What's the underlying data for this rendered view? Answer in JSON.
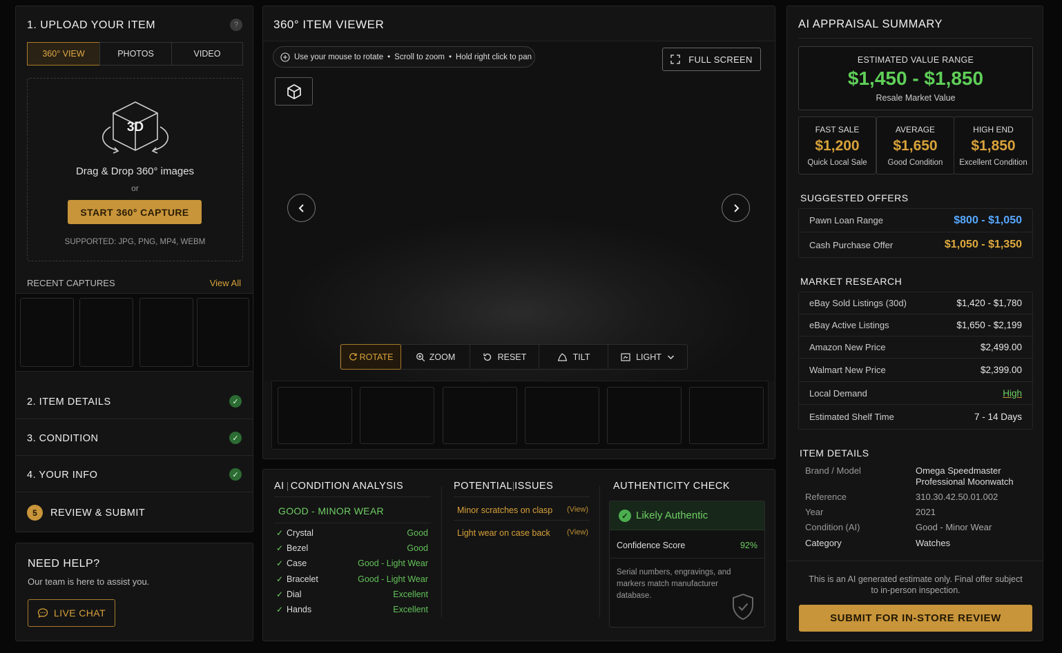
{
  "upload": {
    "title": "1. UPLOAD YOUR ITEM",
    "help_glyph": "?",
    "tabs": [
      "360° VIEW",
      "PHOTOS",
      "VIDEO"
    ],
    "drop_badge": "3D",
    "drop_text": "Drag & Drop 360° images",
    "or": "or",
    "capture_button": "START 360° CAPTURE",
    "supported": "SUPPORTED: JPG, PNG, MP4, WEBM",
    "recent_label": "RECENT CAPTURES",
    "view_all": "View All"
  },
  "steps": [
    {
      "label": "2. ITEM DETAILS"
    },
    {
      "label": "3. CONDITION"
    },
    {
      "label": "4. YOUR INFO"
    },
    {
      "label": "REVIEW & SUBMIT",
      "number": "5"
    }
  ],
  "help": {
    "title": "NEED HELP?",
    "text": "Our team is here to assist you.",
    "chat_button": "LIVE CHAT"
  },
  "viewer": {
    "title": "360° ITEM VIEWER",
    "hint_parts": [
      "Use your mouse to rotate",
      "Scroll to zoom",
      "Hold right click to pan"
    ],
    "fullscreen": "FULL SCREEN",
    "tools": [
      "ROTATE",
      "ZOOM",
      "RESET",
      "TILT",
      "LIGHT"
    ]
  },
  "condition": {
    "title_a": "AI",
    "title_b": "CONDITION ANALYSIS",
    "grade": "GOOD - MINOR WEAR",
    "items": [
      {
        "name": "Crystal",
        "value": "Good"
      },
      {
        "name": "Bezel",
        "value": "Good"
      },
      {
        "name": "Case",
        "value": "Good - Light Wear"
      },
      {
        "name": "Bracelet",
        "value": "Good - Light Wear"
      },
      {
        "name": "Dial",
        "value": "Excellent"
      },
      {
        "name": "Hands",
        "value": "Excellent"
      }
    ]
  },
  "issues": {
    "title_a": "POTENTIAL",
    "title_b": "ISSUES",
    "items": [
      {
        "text": "Minor scratches on clasp",
        "link": "(View)"
      },
      {
        "text": "Light wear on case back",
        "link": "(View)"
      }
    ]
  },
  "authenticity": {
    "title": "AUTHENTICITY CHECK",
    "status": "Likely Authentic",
    "confidence_label": "Confidence Score",
    "confidence_value": "92%",
    "note": "Serial numbers, engravings, and markers match manufacturer database."
  },
  "appraisal": {
    "title": "AI APPRAISAL SUMMARY",
    "est_label": "ESTIMATED VALUE RANGE",
    "est_value": "$1,450 - $1,850",
    "est_sub": "Resale Market Value",
    "tiers": [
      {
        "label": "FAST SALE",
        "value": "$1,200",
        "sub": "Quick Local Sale"
      },
      {
        "label": "AVERAGE",
        "value": "$1,650",
        "sub": "Good Condition"
      },
      {
        "label": "HIGH END",
        "value": "$1,850",
        "sub": "Excellent Condition"
      }
    ],
    "offers_title": "SUGGESTED OFFERS",
    "offers": [
      {
        "label": "Pawn Loan Range",
        "value": "$800 - $1,050"
      },
      {
        "label": "Cash Purchase Offer",
        "value": "$1,050 - $1,350"
      }
    ],
    "market_title": "MARKET RESEARCH",
    "market": [
      {
        "label": "eBay Sold Listings (30d)",
        "value": "$1,420 - $1,780"
      },
      {
        "label": "eBay Active Listings",
        "value": "$1,650 - $2,199"
      },
      {
        "label": "Amazon New Price",
        "value": "$2,499.00"
      },
      {
        "label": "Walmart New Price",
        "value": "$2,399.00"
      },
      {
        "label": "Local Demand",
        "value": "High"
      },
      {
        "label": "Estimated Shelf Time",
        "value": "7 - 14 Days"
      }
    ],
    "details_title": "ITEM DETAILS",
    "details": [
      {
        "label": "Brand / Model",
        "value": "Omega Speedmaster Professional Moonwatch"
      },
      {
        "label": "Reference",
        "value": "310.30.42.50.01.002"
      },
      {
        "label": "Year",
        "value": "2021"
      },
      {
        "label": "Condition (AI)",
        "value": "Good - Minor Wear"
      },
      {
        "label": "Category",
        "value": "Watches"
      }
    ],
    "disclaimer": "This is an AI generated estimate only. Final offer subject to in-person inspection.",
    "submit": "SUBMIT FOR IN-STORE REVIEW"
  }
}
